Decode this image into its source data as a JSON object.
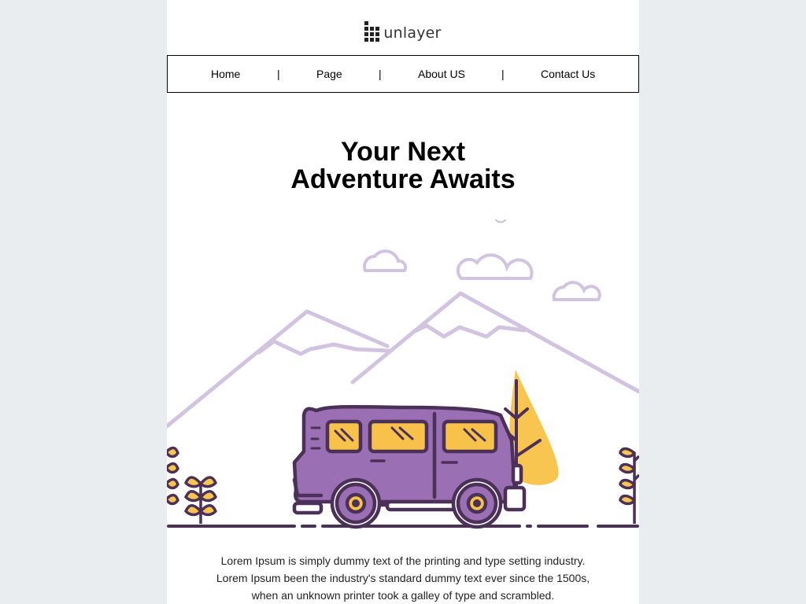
{
  "brand": {
    "name": "unlayer"
  },
  "nav": {
    "items": [
      "Home",
      "Page",
      "About US",
      "Contact Us"
    ],
    "separator": "|"
  },
  "hero": {
    "title_line1": "Your Next",
    "title_line2": "Adventure Awaits"
  },
  "content": {
    "line1": "Lorem Ipsum is simply dummy text of the printing and type setting industry.",
    "line2": "Lorem Ipsum been the industry's standard dummy text ever since the 1500s,",
    "line3": "when an unknown printer took a galley of type and scrambled."
  },
  "colors": {
    "page_bg": "#e9edef",
    "van": "#9a6fb4",
    "van_outline": "#4b3057",
    "window": "#f7c14a",
    "mountain_line": "#d2c4e0",
    "tree": "#f8c650"
  },
  "icons": [
    "unlayer-logo-icon",
    "van-illustration",
    "mountains-illustration"
  ]
}
